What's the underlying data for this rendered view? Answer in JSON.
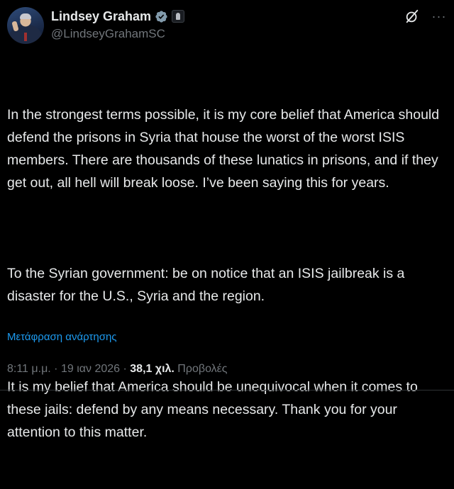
{
  "author": {
    "display_name": "Lindsey Graham",
    "handle": "@LindseyGrahamSC",
    "avatar_icon": "profile-photo",
    "verified_icon": "verified-badge-icon",
    "affiliation_icon": "government-badge-icon"
  },
  "header_actions": {
    "grok_icon": "grok-icon",
    "more_label": "···"
  },
  "tweet": {
    "paragraphs": [
      "In the strongest terms possible, it is my core belief that America should defend the prisons in Syria that house the worst of the worst ISIS members. There are thousands of these lunatics in prisons, and if they get out, all hell will break loose. I’ve been saying this for years.",
      "To the Syrian government: be on notice that an ISIS jailbreak is a disaster for the U.S., Syria and the region.",
      "It is my belief that America should be unequivocal when it comes to these jails: defend by any means necessary. Thank you for your attention to this matter."
    ],
    "translate_label": "Μετάφραση ανάρτησης"
  },
  "meta": {
    "time": "8:11 μ.μ.",
    "separator": " · ",
    "date": "19 ιαν 2026",
    "views_count": "38,1 χιλ.",
    "views_label": " Προβολές"
  },
  "colors": {
    "background": "#000000",
    "text": "#e7e9ea",
    "muted": "#71767b",
    "link": "#1d9bf0",
    "verified": "#829aab"
  }
}
